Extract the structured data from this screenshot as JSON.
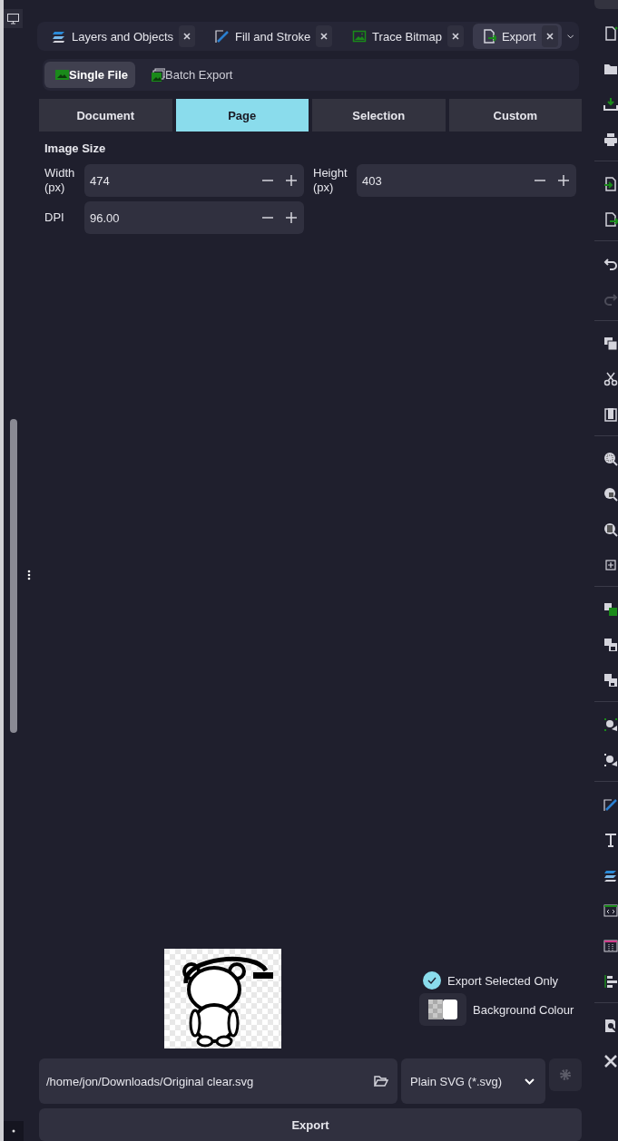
{
  "dock_tabs": [
    {
      "label": "Layers and Objects",
      "selected": false
    },
    {
      "label": "Fill and Stroke",
      "selected": false
    },
    {
      "label": "Trace Bitmap",
      "selected": false
    },
    {
      "label": "Export",
      "selected": true
    }
  ],
  "export_modes": [
    {
      "label": "Single File",
      "selected": true
    },
    {
      "label": "Batch Export",
      "selected": false
    }
  ],
  "area_tabs": [
    {
      "label": "Document",
      "selected": false
    },
    {
      "label": "Page",
      "selected": true
    },
    {
      "label": "Selection",
      "selected": false
    },
    {
      "label": "Custom",
      "selected": false
    }
  ],
  "section_title": "Image Size",
  "size_fields": [
    {
      "label": "Width (px)",
      "value": "474"
    },
    {
      "label": "Height (px)",
      "value": "403"
    },
    {
      "label": "DPI",
      "value": "96.00"
    }
  ],
  "export_selected_only": {
    "label": "Export Selected Only",
    "checked": true
  },
  "background_colour": {
    "label": "Background Colour"
  },
  "file_path": {
    "value": "/home/jon/Downloads/Original clear.svg"
  },
  "format": {
    "value": "Plain SVG (*.svg)"
  },
  "export_button": "Export",
  "toolbar_groups": [
    {
      "buttons": [
        {
          "disabled": false
        },
        {
          "disabled": false
        },
        {
          "disabled": false
        },
        {
          "disabled": false
        }
      ]
    },
    {
      "buttons": [
        {
          "disabled": false
        },
        {
          "disabled": false
        }
      ]
    },
    {
      "buttons": [
        {
          "disabled": false
        },
        {
          "disabled": true
        }
      ]
    },
    {
      "buttons": [
        {
          "disabled": false
        },
        {
          "disabled": false
        },
        {
          "disabled": false
        }
      ]
    },
    {
      "buttons": [
        {
          "disabled": false
        },
        {
          "disabled": false
        },
        {
          "disabled": false
        },
        {
          "disabled": false
        }
      ]
    },
    {
      "buttons": [
        {
          "disabled": false
        },
        {
          "disabled": false
        },
        {
          "disabled": false
        }
      ]
    },
    {
      "buttons": [
        {
          "disabled": false
        },
        {
          "disabled": false
        }
      ]
    },
    {
      "buttons": [
        {
          "disabled": false
        },
        {
          "disabled": false
        },
        {
          "disabled": false
        },
        {
          "disabled": false
        },
        {
          "disabled": false
        },
        {
          "disabled": false
        }
      ]
    },
    {
      "buttons": [
        {
          "disabled": false
        },
        {
          "disabled": false
        }
      ]
    }
  ]
}
